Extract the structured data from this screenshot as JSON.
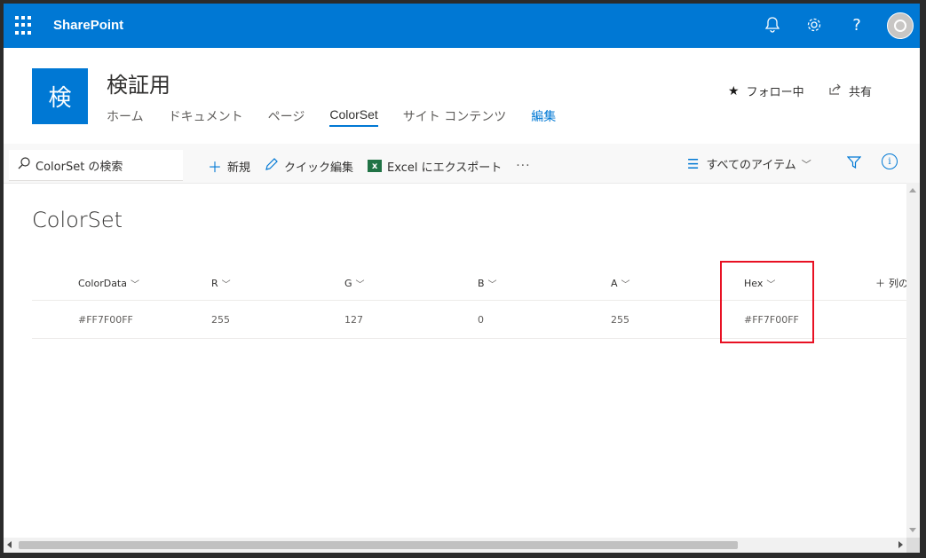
{
  "suite": {
    "brand": "SharePoint",
    "help": "?"
  },
  "site": {
    "logo_letter": "検",
    "title": "検証用",
    "nav": [
      "ホーム",
      "ドキュメント",
      "ページ",
      "ColorSet",
      "サイト コンテンツ",
      "編集"
    ],
    "follow": "フォロー中",
    "share": "共有"
  },
  "commandbar": {
    "search_placeholder": "ColorSet の検索",
    "new": "新規",
    "quick_edit": "クイック編集",
    "export": "Excel にエクスポート",
    "more": "···",
    "view": "すべてのアイテム"
  },
  "list": {
    "title": "ColorSet",
    "columns": [
      "ColorData",
      "R",
      "G",
      "B",
      "A",
      "Hex"
    ],
    "add_column": "列の",
    "rows": [
      [
        "#FF7F00FF",
        "255",
        "127",
        "0",
        "255",
        "#FF7F00FF"
      ]
    ]
  },
  "colors": {
    "accent": "#0078d4",
    "highlight_box": "#e81123"
  }
}
